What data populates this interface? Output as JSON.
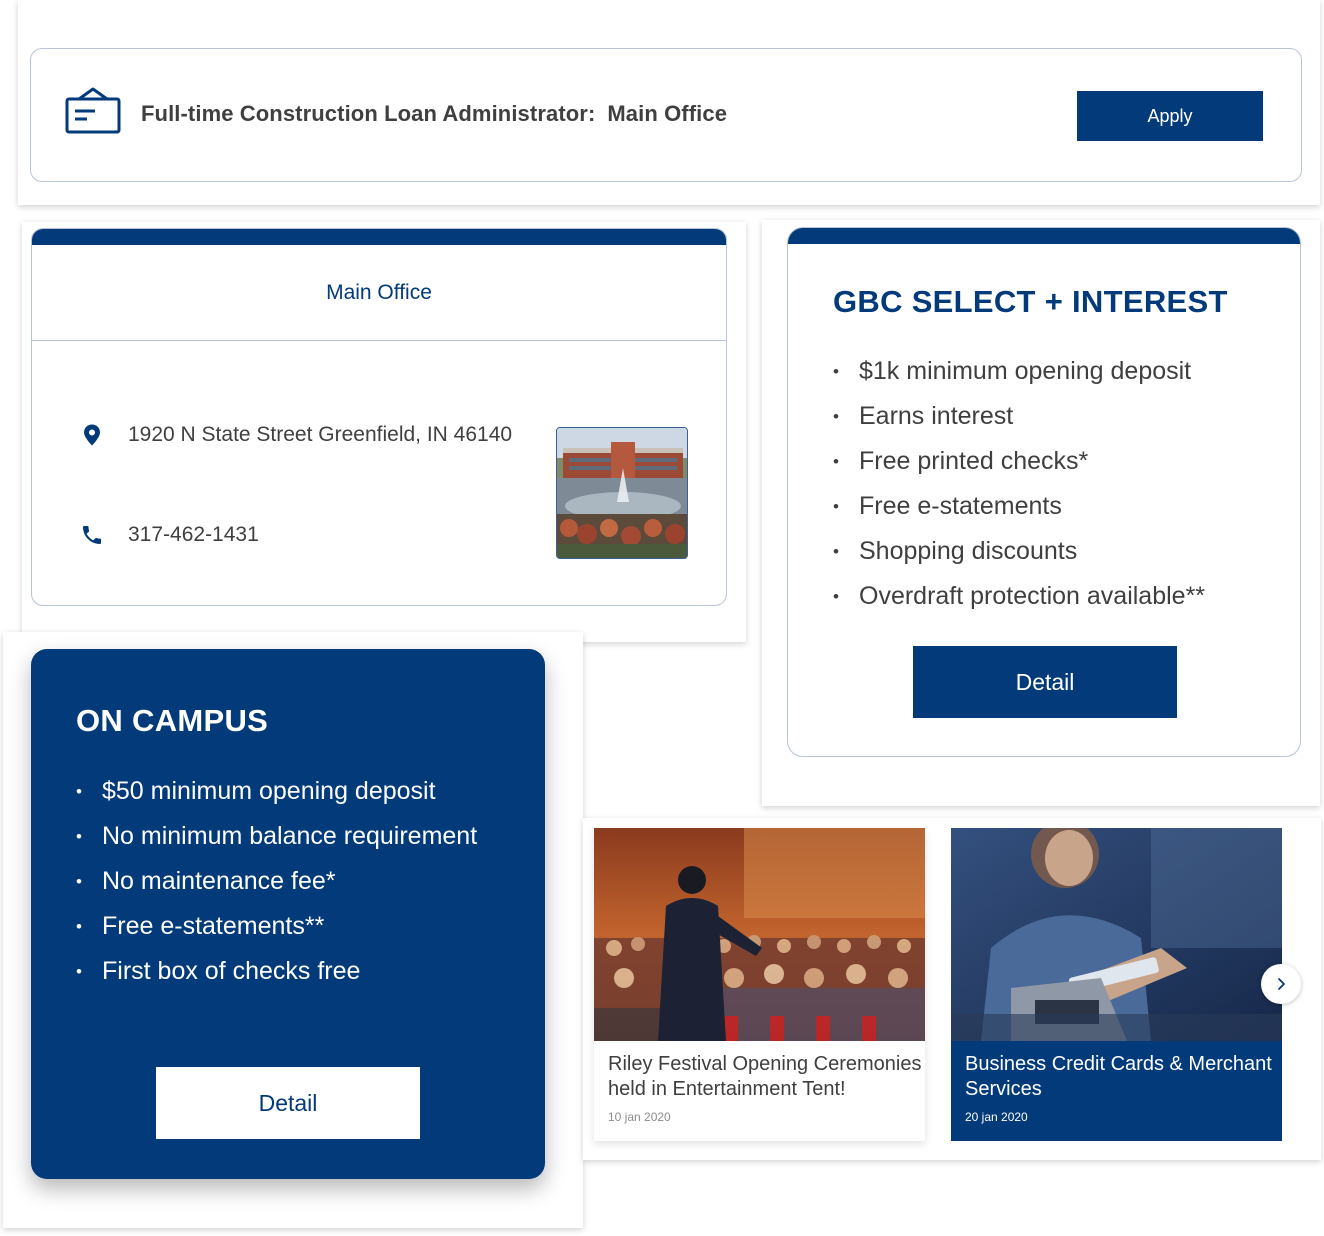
{
  "job": {
    "title": "Full-time Construction Loan Administrator:",
    "location": "Main Office",
    "apply_label": "Apply"
  },
  "office": {
    "heading": "Main Office",
    "address": "1920 N State Street Greenfield, IN 46140",
    "phone": "317-462-1431"
  },
  "gbc": {
    "title": "GBC SELECT + INTEREST",
    "features": [
      "$1k minimum opening deposit",
      "Earns interest",
      "Free printed checks*",
      "Free e-statements",
      "Shopping discounts",
      "Overdraft protection available**"
    ],
    "detail_label": "Detail"
  },
  "campus": {
    "title": "ON CAMPUS",
    "features": [
      "$50 minimum opening deposit",
      "No minimum balance requirement",
      "No maintenance fee*",
      "Free e-statements**",
      "First box of checks free"
    ],
    "detail_label": "Detail"
  },
  "news": {
    "items": [
      {
        "title": "Riley Festival Opening Ceremonies held in Entertainment Tent!",
        "date": "10 jan 2020"
      },
      {
        "title": "Business Credit Cards & Merchant Services",
        "date": "20 jan 2020"
      }
    ]
  },
  "colors": {
    "brand_blue": "#023a7a",
    "border": "#b8c4d8",
    "text": "#3f3f3f"
  }
}
